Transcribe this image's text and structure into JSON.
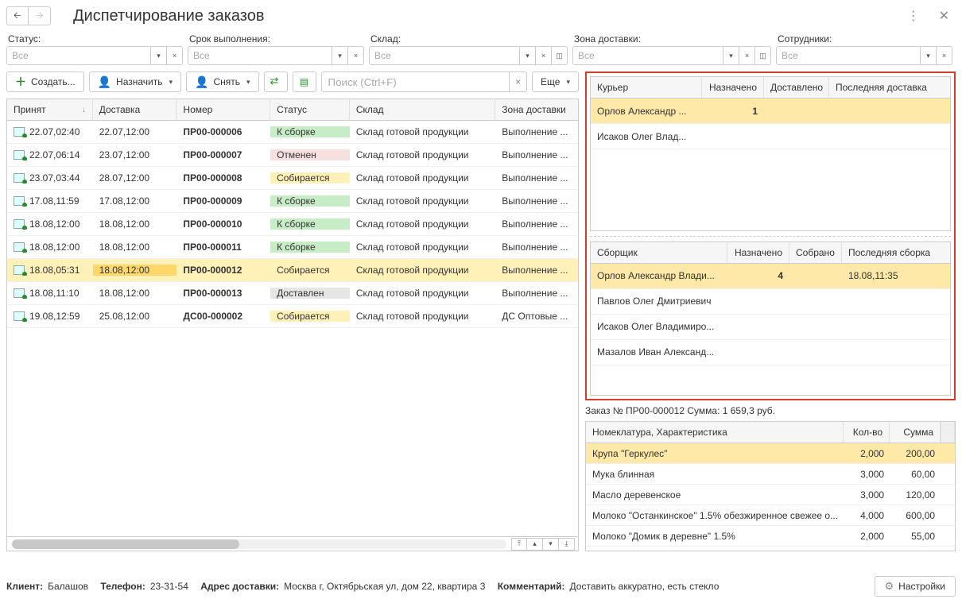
{
  "header": {
    "title": "Диспетчирование заказов"
  },
  "filters": {
    "status": {
      "label": "Статус:",
      "value": "Все"
    },
    "due": {
      "label": "Срок выполнения:",
      "value": "Все"
    },
    "whs": {
      "label": "Склад:",
      "value": "Все"
    },
    "zone": {
      "label": "Зона доставки:",
      "value": "Все"
    },
    "staff": {
      "label": "Сотрудники:",
      "value": "Все"
    }
  },
  "toolbar": {
    "create": "Создать...",
    "assign": "Назначить",
    "remove": "Снять",
    "more": "Еще",
    "search_ph": "Поиск (Ctrl+F)"
  },
  "orders": {
    "cols": {
      "accepted": "Принят",
      "delivery": "Доставка",
      "number": "Номер",
      "status": "Статус",
      "whs": "Склад",
      "zone": "Зона доставки"
    },
    "rows": [
      {
        "accepted": "22.07,02:40",
        "delivery": "22.07,12:00",
        "number": "ПР00-000006",
        "status": "К сборке",
        "status_cls": "st-sborka",
        "whs": "Склад готовой продукции",
        "zone": "Выполнение ..."
      },
      {
        "accepted": "22.07,06:14",
        "delivery": "23.07,12:00",
        "number": "ПР00-000007",
        "status": "Отменен",
        "status_cls": "st-cancel",
        "whs": "Склад готовой продукции",
        "zone": "Выполнение ..."
      },
      {
        "accepted": "23.07,03:44",
        "delivery": "28.07,12:00",
        "number": "ПР00-000008",
        "status": "Собирается",
        "status_cls": "st-sobir",
        "whs": "Склад готовой продукции",
        "zone": "Выполнение ..."
      },
      {
        "accepted": "17.08,11:59",
        "delivery": "17.08,12:00",
        "number": "ПР00-000009",
        "status": "К сборке",
        "status_cls": "st-sborka",
        "whs": "Склад готовой продукции",
        "zone": "Выполнение ..."
      },
      {
        "accepted": "18.08,12:00",
        "delivery": "18.08,12:00",
        "number": "ПР00-000010",
        "status": "К сборке",
        "status_cls": "st-sborka",
        "whs": "Склад готовой продукции",
        "zone": "Выполнение ..."
      },
      {
        "accepted": "18.08,12:00",
        "delivery": "18.08,12:00",
        "number": "ПР00-000011",
        "status": "К сборке",
        "status_cls": "st-sborka",
        "whs": "Склад готовой продукции",
        "zone": "Выполнение ..."
      },
      {
        "accepted": "18.08,05:31",
        "delivery": "18.08,12:00",
        "number": "ПР00-000012",
        "status": "Собирается",
        "status_cls": "st-sobir",
        "whs": "Склад готовой продукции",
        "zone": "Выполнение ...",
        "selected": true
      },
      {
        "accepted": "18.08,11:10",
        "delivery": "18.08,12:00",
        "number": "ПР00-000013",
        "status": "Доставлен",
        "status_cls": "st-dostav",
        "whs": "Склад готовой продукции",
        "zone": "Выполнение ..."
      },
      {
        "accepted": "19.08,12:59",
        "delivery": "25.08,12:00",
        "number": "ДС00-000002",
        "status": "Собирается",
        "status_cls": "st-sobir",
        "whs": "Склад готовой продукции",
        "zone": "ДС Оптовые ..."
      }
    ]
  },
  "couriers": {
    "cols": {
      "name": "Курьер",
      "assigned": "Назначено",
      "delivered": "Доставлено",
      "last": "Последняя доставка"
    },
    "rows": [
      {
        "name": "Орлов Александр ...",
        "assigned": "1",
        "delivered": "",
        "last": "",
        "selected": true
      },
      {
        "name": "Исаков Олег Влад...",
        "assigned": "",
        "delivered": "",
        "last": ""
      }
    ]
  },
  "pickers": {
    "cols": {
      "name": "Сборщик",
      "assigned": "Назначено",
      "picked": "Собрано",
      "last": "Последняя сборка"
    },
    "rows": [
      {
        "name": "Орлов Александр Влади...",
        "assigned": "4",
        "picked": "",
        "last": "18.08,11:35",
        "selected": true
      },
      {
        "name": "Павлов Олег Дмитриевич",
        "assigned": "",
        "picked": "",
        "last": ""
      },
      {
        "name": "Исаков Олег Владимиро...",
        "assigned": "",
        "picked": "",
        "last": ""
      },
      {
        "name": "Мазалов Иван Александ...",
        "assigned": "",
        "picked": "",
        "last": ""
      }
    ]
  },
  "summary": "Заказ № ПР00-000012   Сумма: 1 659,3 руб.",
  "items": {
    "cols": {
      "name": "Номеклатура, Характеристика",
      "qty": "Кол-во",
      "sum": "Сумма"
    },
    "rows": [
      {
        "name": "Крупа \"Геркулес\"",
        "qty": "2,000",
        "sum": "200,00",
        "selected": true
      },
      {
        "name": "Мука блинная",
        "qty": "3,000",
        "sum": "60,00"
      },
      {
        "name": "Масло деревенское",
        "qty": "3,000",
        "sum": "120,00"
      },
      {
        "name": "Молоко \"Останкинское\" 1.5% обезжиренное свежее о...",
        "qty": "4,000",
        "sum": "600,00"
      },
      {
        "name": "Молоко \"Домик в деревне\" 1.5%",
        "qty": "2,000",
        "sum": "55,00"
      }
    ]
  },
  "footer": {
    "client_l": "Клиент:",
    "client_v": "Балашов",
    "phone_l": "Телефон:",
    "phone_v": "23-31-54",
    "addr_l": "Адрес доставки:",
    "addr_v": "Москва г, Октябрьская ул, дом 22, квартира 3",
    "comm_l": "Комментарий:",
    "comm_v": "Доставить аккуратно, есть стекло",
    "settings": "Настройки"
  }
}
